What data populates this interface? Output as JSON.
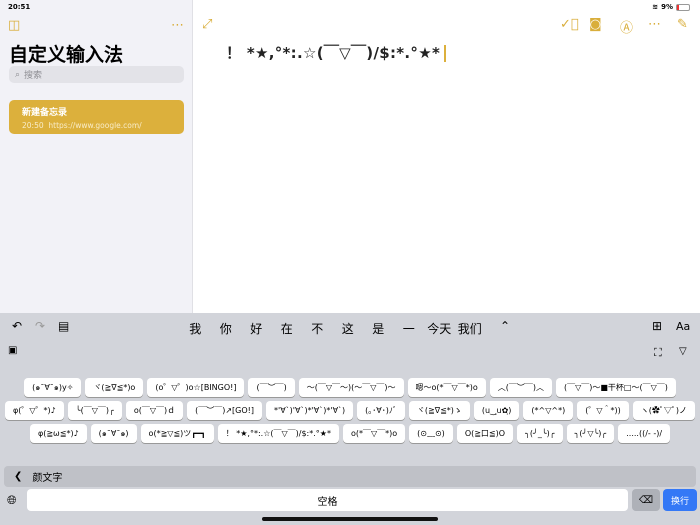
{
  "status": {
    "time": "20:51",
    "battery": "9%"
  },
  "sidebar": {
    "title": "自定义输入法",
    "search_placeholder": "搜索",
    "notes": [
      {
        "title": "新建备忘录",
        "time": "20:50",
        "preview": "https://www.google.com/"
      }
    ]
  },
  "editor": {
    "text": "！ *★,°*:.☆(￣▽￣)/$:*.°★*"
  },
  "keyboard": {
    "candidates": [
      "我",
      "你",
      "好",
      "在",
      "不",
      "这",
      "是",
      "一",
      "今天",
      "我们"
    ],
    "kaomoji_rows": [
      [
        "(๑¯∀¯๑)y✧",
        "ヾ(≧∇≦*)o",
        "(o゜▽゜)o☆[BINGO!]",
        "(￣︶￣)",
        "～(￣▽￣～)(～￣▽￣)～",
        "嗯～o(*￣▽￣*)o",
        "︿(￣︶￣)︿",
        "(￣▽￣)～■干杯□～(￣▽￣)"
      ],
      [
        "φ(゜▽゜*)♪",
        "╰(￣▽￣)╭",
        "o(￣▽￣)ｄ",
        "(￣︶￣)↗[GO!]",
        "*'∀`)'∀`)*'∀`)*'∀`)",
        "(｡･∀･)ﾉﾞ",
        "ヾ(≧∇≦*)ゝ",
        "(u‿ฺu✿ฺ)",
        "(*^▽^*)",
        "(゜▽＾*))",
        "ヽ(✿ﾟ▽ﾟ)ノ"
      ],
      [
        "φ(≧ω≦*)♪",
        "(๑¯∀¯๑)",
        "o(*≧▽≦)ツ┏━┓",
        "！ *★,°*:.☆(￣▽￣)/$:*.°★*",
        "o(*￣▽￣*)o",
        "(⊙﹏⊙)",
        "O(≧口≦)O",
        "╮(╯_╰)╭",
        "╮(╯▽╰)╭",
        ".....((/- -)/"
      ]
    ],
    "category": "颜文字",
    "space": "空格",
    "return": "换行"
  }
}
